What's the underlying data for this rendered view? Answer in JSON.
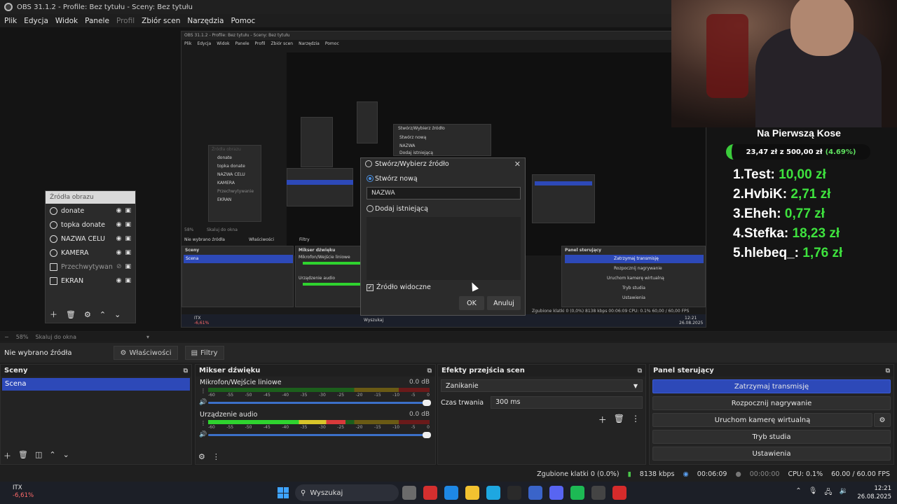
{
  "window": {
    "title": "OBS 31.1.2 - Profile: Bez tytułu - Sceny: Bez tytułu"
  },
  "menu": [
    "Plik",
    "Edycja",
    "Widok",
    "Panele",
    "Profil",
    "Zbiór scen",
    "Narzędzia",
    "Pomoc"
  ],
  "nested_preview": {
    "title": "OBS 31.1.2 - Profile: Bez tytułu - Sceny: Bez tytułu",
    "menu": [
      "Plik",
      "Edycja",
      "Widok",
      "Panele",
      "Profil",
      "Zbiór scen",
      "Narzędzia",
      "Pomoc"
    ],
    "labels": {
      "no_source": "Nie wybrano źródła",
      "properties": "Właściwości",
      "filters": "Filtry",
      "scenes": "Sceny",
      "scene": "Scena",
      "mixer": "Mikser dźwięku",
      "mic": "Mikrofon/Wejście liniowe",
      "audio": "Urządzenie audio",
      "control": "Panel sterujący",
      "stop": "Zatrzymaj transmisję",
      "rec": "Rozpocznij nagrywanie",
      "vcam": "Uruchom kamerę wirtualną",
      "studio": "Tryb studia",
      "settings": "Ustawienia",
      "zoom": "58%",
      "scale": "Skaluj do okna",
      "stats": "Zgubione klatki 0 (0,0%)   8138 kbps   00:06:09   CPU: 0.1%   60,00 / 60,00 FPS",
      "search": "Wyszukaj",
      "time": "12:21",
      "date": "26.08.2025",
      "ticker": "ITX",
      "ticker_val": "-6,61%",
      "dlg_title": "Stwórz/Wybierz źródło",
      "dlg_new": "Stwórz nową",
      "dlg_name": "NAZWA",
      "dlg_existing": "Dodaj istniejącą",
      "src_title": "Źródła obrazu",
      "donate": "donate",
      "topka": "topka donate",
      "cel": "NAZWA CELU",
      "kam": "KAMERA",
      "przech": "Przechwytywanie",
      "ekran": "EKRAN"
    }
  },
  "webcam": {
    "description_icon": "webcam-feed"
  },
  "donate_widget": {
    "title": "Na Pierwszą Kose",
    "progress_text": "23,47 zł z 500,00 zł",
    "progress_pct": "(4.69%)",
    "progress_fraction": 0.0469,
    "top": [
      {
        "rank": "1.",
        "name": "Test:",
        "amount": "10,00 zł"
      },
      {
        "rank": "2.",
        "name": "HvbiK:",
        "amount": "2,71 zł"
      },
      {
        "rank": "3.",
        "name": "Eheh:",
        "amount": "0,77 zł"
      },
      {
        "rank": "4.",
        "name": "Stefka:",
        "amount": "18,23 zł"
      },
      {
        "rank": "5.",
        "name": "hlebeq_:",
        "amount": "1,76 zł"
      }
    ]
  },
  "sources": {
    "title": "Źródła obrazu",
    "items": [
      {
        "label": "donate",
        "icon": "globe-icon",
        "visible": true
      },
      {
        "label": "topka donate",
        "icon": "globe-icon",
        "visible": true
      },
      {
        "label": "NAZWA CELU",
        "icon": "globe-icon",
        "visible": true
      },
      {
        "label": "KAMERA",
        "icon": "camera-icon",
        "visible": true
      },
      {
        "label": "Przechwytywanie",
        "icon": "window-capture-icon",
        "visible": false
      },
      {
        "label": "EKRAN",
        "icon": "monitor-icon",
        "visible": true
      }
    ]
  },
  "dialog": {
    "title": "Stwórz/Wybierz źródło",
    "create_new": "Stwórz nową",
    "name_value": "NAZWA",
    "add_existing": "Dodaj istniejącą",
    "visible_label": "Źródło widoczne",
    "ok": "OK",
    "cancel": "Anuluj"
  },
  "zoombar": {
    "zoom": "58%",
    "scale": "Skaluj do okna"
  },
  "propbar": {
    "no_source": "Nie wybrano źródła",
    "properties": "Właściwości",
    "filters": "Filtry"
  },
  "scenes": {
    "title": "Sceny",
    "items": [
      "Scena"
    ]
  },
  "mixer": {
    "title": "Mikser dźwięku",
    "ticks": [
      "-60",
      "-55",
      "-50",
      "-45",
      "-40",
      "-35",
      "-30",
      "-25",
      "-20",
      "-15",
      "-10",
      "-5",
      "0"
    ],
    "channels": [
      {
        "name": "Mikrofon/Wejście liniowe",
        "db": "0.0 dB",
        "level": 0.0,
        "volume": 1.0
      },
      {
        "name": "Urządzenie audio",
        "db": "0.0 dB",
        "level": 0.62,
        "volume": 1.0
      }
    ]
  },
  "transitions": {
    "title": "Efekty przejścia scen",
    "selected": "Zanikanie",
    "duration_label": "Czas trwania",
    "duration": "300 ms"
  },
  "controls": {
    "title": "Panel sterujący",
    "stop_stream": "Zatrzymaj transmisję",
    "start_record": "Rozpocznij nagrywanie",
    "virtual_cam": "Uruchom kamerę wirtualną",
    "studio_mode": "Tryb studia",
    "settings": "Ustawienia"
  },
  "status": {
    "dropped": "Zgubione klatki 0 (0.0%)",
    "bitrate": "8138 kbps",
    "stream_time": "00:06:09",
    "rec_time": "00:00:00",
    "cpu": "CPU: 0.1%",
    "fps": "60.00 / 60.00 FPS"
  },
  "taskbar": {
    "ticker": "ITX",
    "ticker_change": "-6,61%",
    "search": "Wyszukaj",
    "time": "12:21",
    "date": "26.08.2025",
    "app_colors": [
      "#6b6b6b",
      "#d32f2f",
      "#1e88e5",
      "#f2c230",
      "#1ea7e1",
      "#2a2a2a",
      "#3a64c9",
      "#5865f2",
      "#1db954",
      "#444444",
      "#d52b2b"
    ]
  }
}
